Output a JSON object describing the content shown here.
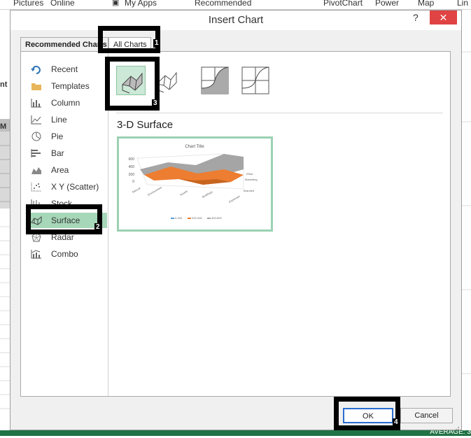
{
  "ribbon": {
    "items": [
      "Pictures",
      "Online",
      "My Apps",
      "Recommended",
      "PivotChart",
      "Power",
      "Map",
      "Lin"
    ]
  },
  "dialog": {
    "title": "Insert Chart",
    "help": "?",
    "close": "✕",
    "tabs": [
      "Recommended Charts",
      "All Charts"
    ],
    "categories": [
      {
        "label": "Recent",
        "icon": "recent-icon"
      },
      {
        "label": "Templates",
        "icon": "folder-icon"
      },
      {
        "label": "Column",
        "icon": "column-chart-icon"
      },
      {
        "label": "Line",
        "icon": "line-chart-icon"
      },
      {
        "label": "Pie",
        "icon": "pie-chart-icon"
      },
      {
        "label": "Bar",
        "icon": "bar-chart-icon"
      },
      {
        "label": "Area",
        "icon": "area-chart-icon"
      },
      {
        "label": "X Y (Scatter)",
        "icon": "scatter-chart-icon"
      },
      {
        "label": "Stock",
        "icon": "stock-chart-icon"
      },
      {
        "label": "Surface",
        "icon": "surface-chart-icon"
      },
      {
        "label": "Radar",
        "icon": "radar-chart-icon"
      },
      {
        "label": "Combo",
        "icon": "combo-chart-icon"
      }
    ],
    "selected_category": "Surface",
    "subtype_title": "3-D Surface",
    "preview": {
      "chart_title": "Chart Title",
      "y_ticks": [
        "600",
        "400",
        "200",
        "0"
      ],
      "x_labels": [
        "Recruit",
        "Environment",
        "Assets",
        "Buildings",
        "Expenses"
      ],
      "z_labels": [
        "Effort",
        "Marketing",
        "Branded"
      ],
      "legend": [
        "0-200",
        "200-400",
        "400-600"
      ],
      "colors": [
        "#5b9bd5",
        "#ed7d31",
        "#a5a5a5"
      ]
    },
    "ok_label": "OK",
    "cancel_label": "Cancel"
  },
  "annotations": [
    "1",
    "2",
    "3",
    "4"
  ],
  "status": {
    "text": "AVERAGE: 3"
  },
  "colors": {
    "accent": "#217346",
    "selection": "#a6d7b8",
    "close": "#e04343"
  }
}
